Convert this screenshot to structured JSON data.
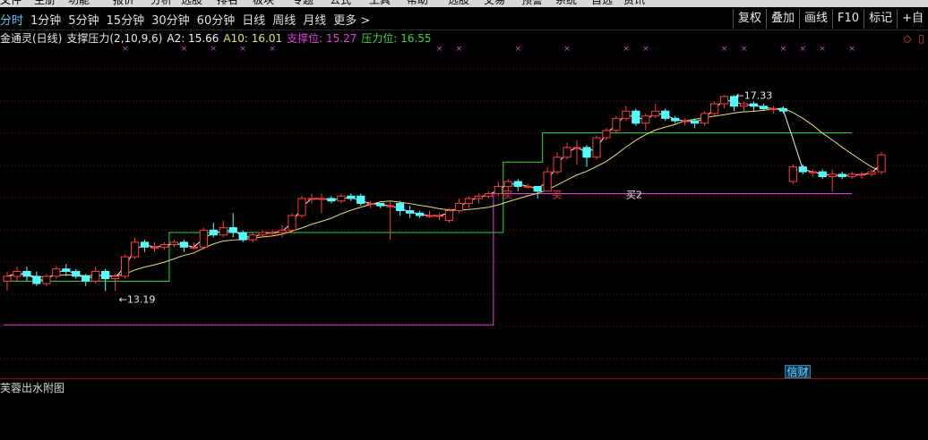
{
  "top_menu": [
    "文件",
    "主册",
    "功能",
    "报价",
    "分析",
    "选股",
    "排名",
    "板块",
    "专题",
    "公式",
    "工具",
    "帮助",
    "选股",
    "交易",
    "预警",
    "系统",
    "自选",
    "资讯"
  ],
  "toolbar": {
    "periods": [
      "分时",
      "1分钟",
      "5分钟",
      "15分钟",
      "30分钟",
      "60分钟",
      "日线",
      "周线",
      "月线",
      "更多 >"
    ],
    "active_period": "分时",
    "right_buttons": [
      "复权",
      "叠加",
      "画线",
      "F10",
      "标记",
      "+自"
    ]
  },
  "indicator": {
    "name": "金通灵(日线)",
    "formula": "支撑压力(2,10,9,6)",
    "a2": "A2: 15.66",
    "a10": "A10: 16.01",
    "support": "支撑位: 15.27",
    "resistance": "压力位: 16.55",
    "panel_controls": "◇ ▯"
  },
  "annotations": {
    "low_label": "←13.19",
    "high_label": "←17.33",
    "buy_label": "买",
    "buy2_label": "买2",
    "finance_badge": "信财"
  },
  "subchart": {
    "title": "芙蓉出水附图"
  },
  "colors": {
    "up": "#ff3d3d",
    "down": "#54ffff",
    "a2": "#f0f0f0",
    "a10": "#e8e070",
    "support": "#e040e0",
    "resistance": "#38d838",
    "marker": "#d040d0",
    "grid": "#6a0e0e"
  },
  "chart_data": {
    "type": "candlestick",
    "price_range": [
      11.5,
      18.2
    ],
    "candles": [
      {
        "o": 13.5,
        "c": 13.6,
        "h": 13.7,
        "l": 13.3
      },
      {
        "o": 13.6,
        "c": 13.7,
        "h": 13.8,
        "l": 13.5
      },
      {
        "o": 13.7,
        "c": 13.6,
        "h": 13.8,
        "l": 13.5
      },
      {
        "o": 13.6,
        "c": 13.45,
        "h": 13.7,
        "l": 13.4
      },
      {
        "o": 13.45,
        "c": 13.6,
        "h": 13.65,
        "l": 13.4
      },
      {
        "o": 13.6,
        "c": 13.75,
        "h": 13.8,
        "l": 13.55
      },
      {
        "o": 13.75,
        "c": 13.7,
        "h": 13.85,
        "l": 13.6
      },
      {
        "o": 13.7,
        "c": 13.6,
        "h": 13.75,
        "l": 13.55
      },
      {
        "o": 13.6,
        "c": 13.5,
        "h": 13.65,
        "l": 13.4
      },
      {
        "o": 13.5,
        "c": 13.7,
        "h": 13.8,
        "l": 13.45
      },
      {
        "o": 13.7,
        "c": 13.55,
        "h": 13.75,
        "l": 13.3
      },
      {
        "o": 13.55,
        "c": 13.6,
        "h": 13.65,
        "l": 13.3
      },
      {
        "o": 13.6,
        "c": 14.0,
        "h": 14.05,
        "l": 13.55
      },
      {
        "o": 14.0,
        "c": 14.3,
        "h": 14.4,
        "l": 13.95
      },
      {
        "o": 14.3,
        "c": 14.2,
        "h": 14.35,
        "l": 14.1
      },
      {
        "o": 14.2,
        "c": 14.2,
        "h": 14.3,
        "l": 14.1
      },
      {
        "o": 14.2,
        "c": 14.25,
        "h": 14.3,
        "l": 14.15
      },
      {
        "o": 14.25,
        "c": 14.3,
        "h": 14.35,
        "l": 14.2
      },
      {
        "o": 14.3,
        "c": 14.2,
        "h": 14.35,
        "l": 14.1
      },
      {
        "o": 14.2,
        "c": 14.2,
        "h": 14.3,
        "l": 14.15
      },
      {
        "o": 14.2,
        "c": 14.55,
        "h": 14.6,
        "l": 14.15
      },
      {
        "o": 14.55,
        "c": 14.45,
        "h": 14.7,
        "l": 14.4
      },
      {
        "o": 14.45,
        "c": 14.6,
        "h": 14.75,
        "l": 14.4
      },
      {
        "o": 14.6,
        "c": 14.5,
        "h": 14.9,
        "l": 14.4
      },
      {
        "o": 14.5,
        "c": 14.35,
        "h": 14.55,
        "l": 14.3
      },
      {
        "o": 14.35,
        "c": 14.45,
        "h": 14.5,
        "l": 14.3
      },
      {
        "o": 14.45,
        "c": 14.5,
        "h": 14.55,
        "l": 14.4
      },
      {
        "o": 14.5,
        "c": 14.5,
        "h": 14.55,
        "l": 14.45
      },
      {
        "o": 14.5,
        "c": 14.55,
        "h": 14.65,
        "l": 14.4
      },
      {
        "o": 14.55,
        "c": 14.85,
        "h": 14.9,
        "l": 14.5
      },
      {
        "o": 14.85,
        "c": 15.2,
        "h": 15.25,
        "l": 14.8
      },
      {
        "o": 15.2,
        "c": 15.2,
        "h": 15.3,
        "l": 15.1
      },
      {
        "o": 15.2,
        "c": 15.2,
        "h": 15.3,
        "l": 14.9
      },
      {
        "o": 15.2,
        "c": 15.15,
        "h": 15.25,
        "l": 15.1
      },
      {
        "o": 15.15,
        "c": 15.25,
        "h": 15.3,
        "l": 15.1
      },
      {
        "o": 15.25,
        "c": 15.2,
        "h": 15.3,
        "l": 15.15
      },
      {
        "o": 15.25,
        "c": 15.1,
        "h": 15.3,
        "l": 15.05
      },
      {
        "o": 15.1,
        "c": 15.1,
        "h": 15.15,
        "l": 15.0
      },
      {
        "o": 15.1,
        "c": 15.05,
        "h": 15.1,
        "l": 15.0
      },
      {
        "o": 15.05,
        "c": 15.05,
        "h": 15.15,
        "l": 14.35
      },
      {
        "o": 15.1,
        "c": 14.95,
        "h": 15.15,
        "l": 14.85
      },
      {
        "o": 14.95,
        "c": 14.9,
        "h": 15.05,
        "l": 14.8
      },
      {
        "o": 14.9,
        "c": 14.85,
        "h": 14.95,
        "l": 14.8
      },
      {
        "o": 14.85,
        "c": 14.85,
        "h": 14.95,
        "l": 14.8
      },
      {
        "o": 14.85,
        "c": 14.85,
        "h": 14.9,
        "l": 14.75
      },
      {
        "o": 14.75,
        "c": 14.95,
        "h": 15.0,
        "l": 14.7
      },
      {
        "o": 14.95,
        "c": 15.1,
        "h": 15.2,
        "l": 14.9
      },
      {
        "o": 15.1,
        "c": 15.2,
        "h": 15.25,
        "l": 15.0
      },
      {
        "o": 15.2,
        "c": 15.25,
        "h": 15.3,
        "l": 15.1
      },
      {
        "o": 15.25,
        "c": 15.3,
        "h": 15.35,
        "l": 15.2
      },
      {
        "o": 15.3,
        "c": 15.45,
        "h": 15.55,
        "l": 15.25
      },
      {
        "o": 15.45,
        "c": 15.55,
        "h": 15.6,
        "l": 15.35
      },
      {
        "o": 15.55,
        "c": 15.45,
        "h": 15.6,
        "l": 15.35
      },
      {
        "o": 15.45,
        "c": 15.45,
        "h": 15.5,
        "l": 15.4
      },
      {
        "o": 15.45,
        "c": 15.35,
        "h": 15.45,
        "l": 15.2
      },
      {
        "o": 15.35,
        "c": 15.75,
        "h": 15.85,
        "l": 15.35
      },
      {
        "o": 15.75,
        "c": 16.05,
        "h": 16.15,
        "l": 15.7
      },
      {
        "o": 16.05,
        "c": 16.25,
        "h": 16.35,
        "l": 16.0
      },
      {
        "o": 16.25,
        "c": 16.25,
        "h": 16.4,
        "l": 15.9
      },
      {
        "o": 16.25,
        "c": 16.05,
        "h": 16.3,
        "l": 15.85
      },
      {
        "o": 16.05,
        "c": 16.45,
        "h": 16.5,
        "l": 16.0
      },
      {
        "o": 16.45,
        "c": 16.6,
        "h": 16.65,
        "l": 16.4
      },
      {
        "o": 16.6,
        "c": 16.85,
        "h": 16.9,
        "l": 16.55
      },
      {
        "o": 16.85,
        "c": 17.0,
        "h": 17.1,
        "l": 16.8
      },
      {
        "o": 17.0,
        "c": 16.75,
        "h": 17.05,
        "l": 16.7
      },
      {
        "o": 16.75,
        "c": 16.9,
        "h": 16.95,
        "l": 16.6
      },
      {
        "o": 16.9,
        "c": 17.0,
        "h": 17.15,
        "l": 16.85
      },
      {
        "o": 17.0,
        "c": 16.85,
        "h": 17.05,
        "l": 16.8
      },
      {
        "o": 16.85,
        "c": 16.8,
        "h": 16.9,
        "l": 16.75
      },
      {
        "o": 16.8,
        "c": 16.8,
        "h": 16.85,
        "l": 16.7
      },
      {
        "o": 16.8,
        "c": 16.75,
        "h": 16.85,
        "l": 16.65
      },
      {
        "o": 16.75,
        "c": 16.95,
        "h": 17.0,
        "l": 16.7
      },
      {
        "o": 16.95,
        "c": 17.15,
        "h": 17.2,
        "l": 16.9
      },
      {
        "o": 17.15,
        "c": 17.3,
        "h": 17.33,
        "l": 17.05
      },
      {
        "o": 17.3,
        "c": 17.1,
        "h": 17.33,
        "l": 17.0
      },
      {
        "o": 17.1,
        "c": 17.15,
        "h": 17.2,
        "l": 17.0
      },
      {
        "o": 17.15,
        "c": 17.1,
        "h": 17.2,
        "l": 17.0
      },
      {
        "o": 17.1,
        "c": 17.05,
        "h": 17.15,
        "l": 17.0
      },
      {
        "o": 17.05,
        "c": 17.05,
        "h": 17.1,
        "l": 16.95
      },
      {
        "o": 17.05,
        "c": 17.0,
        "h": 17.1,
        "l": 16.95
      },
      {
        "o": 15.55,
        "c": 15.85,
        "h": 15.9,
        "l": 15.5
      },
      {
        "o": 15.85,
        "c": 15.75,
        "h": 15.9,
        "l": 15.7
      },
      {
        "o": 15.75,
        "c": 15.75,
        "h": 15.8,
        "l": 15.65
      },
      {
        "o": 15.75,
        "c": 15.65,
        "h": 15.8,
        "l": 15.6
      },
      {
        "o": 15.65,
        "c": 15.7,
        "h": 15.8,
        "l": 15.35
      },
      {
        "o": 15.7,
        "c": 15.65,
        "h": 15.75,
        "l": 15.6
      },
      {
        "o": 15.65,
        "c": 15.7,
        "h": 15.75,
        "l": 15.6
      },
      {
        "o": 15.7,
        "c": 15.7,
        "h": 15.75,
        "l": 15.6
      },
      {
        "o": 15.7,
        "c": 15.75,
        "h": 15.8,
        "l": 15.65
      },
      {
        "o": 15.75,
        "c": 16.1,
        "h": 16.15,
        "l": 15.7
      }
    ],
    "x_markers": [
      12,
      18,
      21,
      24,
      27,
      44,
      46,
      52,
      57,
      63,
      65,
      73,
      75,
      79,
      81,
      83,
      86
    ],
    "support_steps": [
      {
        "from": 0,
        "to": 49,
        "value": 12.6
      },
      {
        "from": 50,
        "to": 86,
        "value": 15.3
      }
    ],
    "resistance_steps": [
      {
        "from": 0,
        "to": 16,
        "value": 13.5
      },
      {
        "from": 17,
        "to": 50,
        "value": 14.5
      },
      {
        "from": 51,
        "to": 54,
        "value": 15.95
      },
      {
        "from": 55,
        "to": 86,
        "value": 16.55
      }
    ]
  }
}
